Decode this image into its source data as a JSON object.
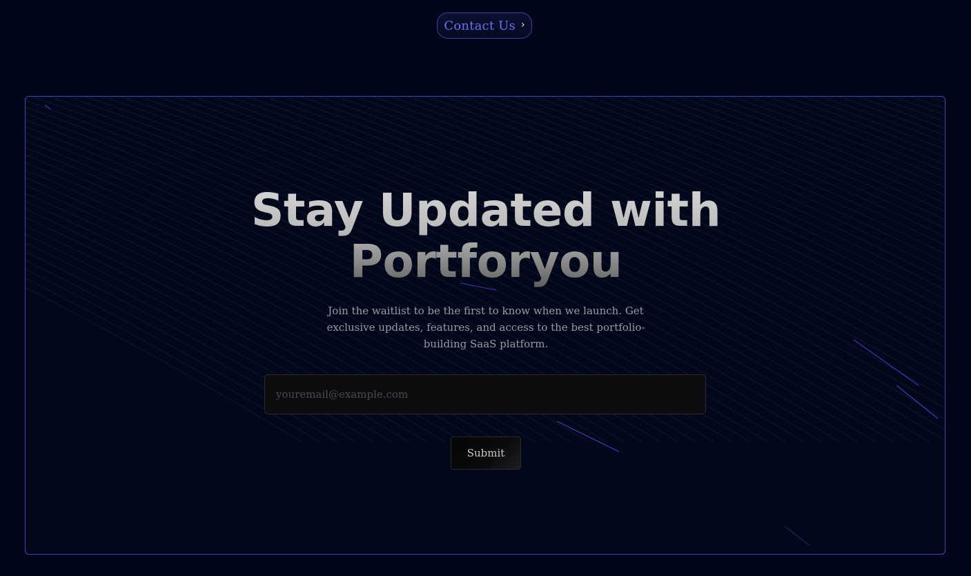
{
  "nav": {
    "contact_label": "Contact Us",
    "chevron_icon": "chevron-right-icon"
  },
  "hero": {
    "headline_line1": "Stay Updated with",
    "headline_line2": "Portforyou",
    "subtitle": "Join the waitlist to be the first to know when we launch. Get exclusive updates, features, and access to the best portfolio-building SaaS platform."
  },
  "form": {
    "email_placeholder": "youremail@example.com",
    "email_value": "",
    "submit_label": "Submit"
  },
  "colors": {
    "background": "#02061a",
    "accent": "#6b6ff0",
    "card_border": "#3e4ab0"
  }
}
